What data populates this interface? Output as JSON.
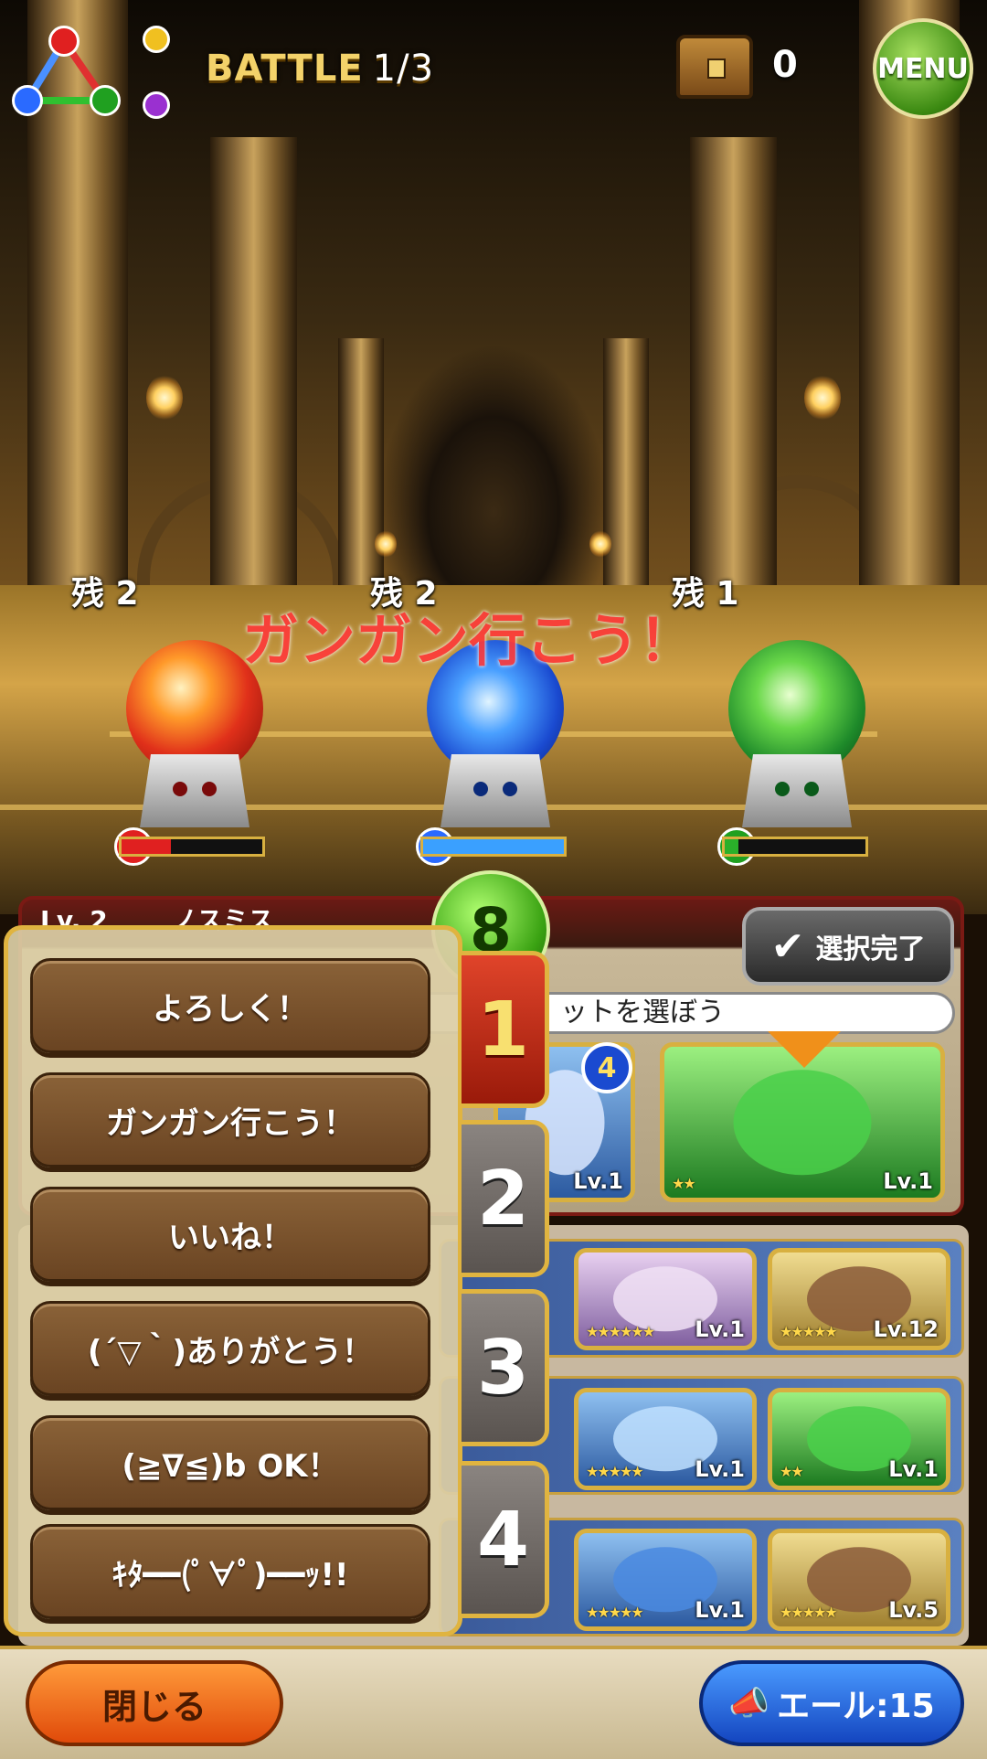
{
  "hud": {
    "battle_label": "BATTLE",
    "battle_progress": "1/3",
    "treasure_count": "0",
    "menu_label": "MENU"
  },
  "enemies": [
    {
      "remain_label": "残 2",
      "element": "fire",
      "hp_fraction": 0.35,
      "hp_color": "#e02020"
    },
    {
      "remain_label": "残 2",
      "element": "water",
      "hp_fraction": 1.0,
      "hp_color": "#3aa0ff"
    },
    {
      "remain_label": "残 1",
      "element": "wind",
      "hp_fraction": 0.1,
      "hp_color": "#2ab02a"
    }
  ],
  "floating_message": "ガンガン行こう！",
  "party": {
    "member_count": "8",
    "select_done_label": "選択完了",
    "hint_text": "ットを選ぼう",
    "lv_label": "Lv. 2",
    "name": "ノスミス"
  },
  "cards": {
    "top_row": [
      {
        "lv": "Lv.1",
        "badge": "4"
      },
      {
        "lv": "Lv.1",
        "stars": "★★"
      }
    ],
    "rows": [
      [
        {
          "lv": "Lv.1",
          "stars": "★★★★★★"
        },
        {
          "lv": "Lv.12",
          "stars": "★★★★★"
        }
      ],
      [
        {
          "lv": "Lv.1",
          "stars": "★★★★★"
        },
        {
          "lv": "Lv.1",
          "stars": "★★"
        }
      ],
      [
        {
          "lv": "Lv.1",
          "stars": "★★★★★"
        },
        {
          "lv": "Lv.5",
          "stars": "★★★★★"
        }
      ]
    ]
  },
  "chat": {
    "messages": [
      "よろしく！",
      "ガンガン行こう！",
      "いいね！",
      "(´▽｀)ありがとう！",
      "(≧∇≦)b OK！",
      "ｷﾀ━━(ﾟ∀ﾟ)━━ｯ!!"
    ],
    "pages": [
      "1",
      "2",
      "3",
      "4"
    ],
    "active_page": "1"
  },
  "footer": {
    "close_label": "閉じる",
    "cheer_label": "エール:15"
  }
}
